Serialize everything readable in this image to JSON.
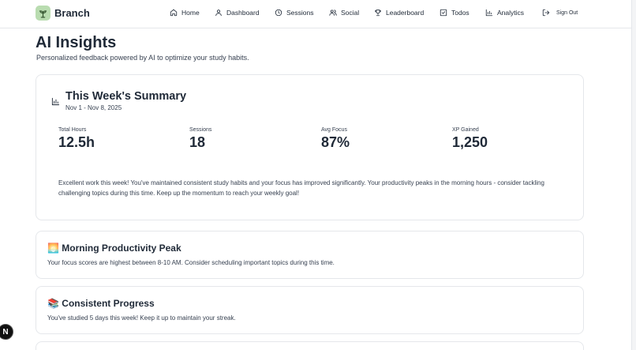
{
  "app": {
    "name": "Branch"
  },
  "nav": {
    "items": [
      {
        "label": "Home",
        "icon": "home-icon"
      },
      {
        "label": "Dashboard",
        "icon": "user-icon"
      },
      {
        "label": "Sessions",
        "icon": "clock-icon"
      },
      {
        "label": "Social",
        "icon": "users-icon"
      },
      {
        "label": "Leaderboard",
        "icon": "trophy-icon"
      },
      {
        "label": "Todos",
        "icon": "checkbox-icon"
      },
      {
        "label": "Analytics",
        "icon": "bar-chart-icon"
      }
    ],
    "signout_label": "Sign Out"
  },
  "page": {
    "title": "AI Insights",
    "subtitle": "Personalized feedback powered by AI to optimize your study habits."
  },
  "summary": {
    "title": "This Week's Summary",
    "date_range": "Nov 1 - Nov 8, 2025",
    "stats": [
      {
        "label": "Total Hours",
        "value": "12.5h"
      },
      {
        "label": "Sessions",
        "value": "18"
      },
      {
        "label": "Avg Focus",
        "value": "87%"
      },
      {
        "label": "XP Gained",
        "value": "1,250"
      }
    ],
    "text": "Excellent work this week! You've maintained consistent study habits and your focus has improved significantly. Your productivity peaks in the morning hours - consider tackling challenging topics during this time. Keep up the momentum to reach your weekly goal!"
  },
  "insights": [
    {
      "title": "🌅 Morning Productivity Peak",
      "description": "Your focus scores are highest between 8-10 AM. Consider scheduling important topics during this time."
    },
    {
      "title": "📚 Consistent Progress",
      "description": "You've studied 5 days this week! Keep it up to maintain your streak."
    }
  ],
  "fab": {
    "label": "N"
  }
}
